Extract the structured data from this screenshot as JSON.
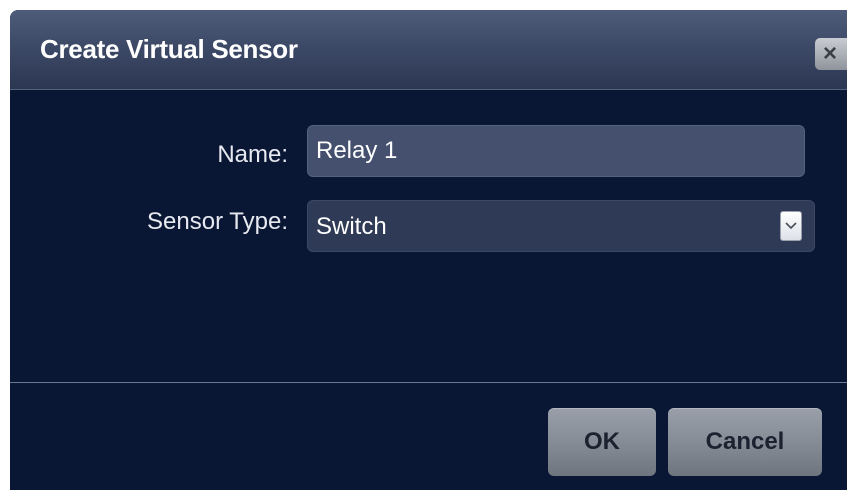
{
  "dialog": {
    "title": "Create Virtual Sensor",
    "close_icon": "close-icon",
    "close_glyph": "×"
  },
  "form": {
    "name_label": "Name:",
    "name_value": "Relay 1",
    "type_label": "Sensor Type:",
    "type_value": "Switch",
    "type_arrow_icon": "chevron-down-icon"
  },
  "footer": {
    "ok_label": "OK",
    "cancel_label": "Cancel"
  },
  "colors": {
    "dialog_background": "#091634",
    "titlebar": "#3d4a67",
    "input_background": "#44506e",
    "button": "#868c96"
  }
}
